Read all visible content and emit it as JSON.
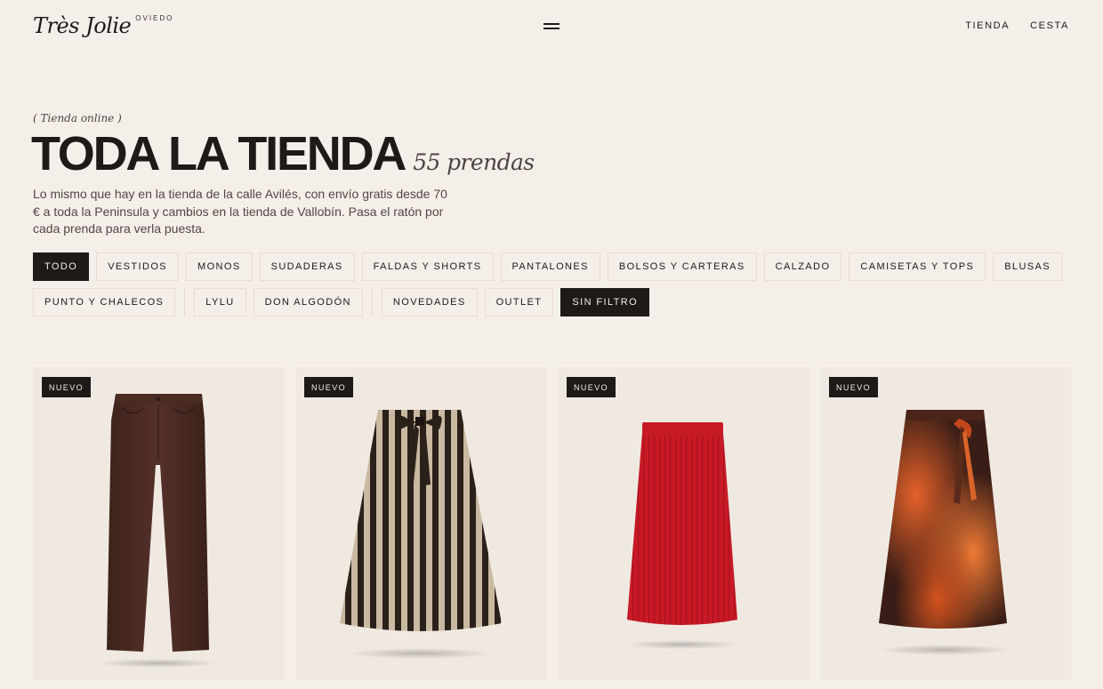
{
  "header": {
    "logo": "Très Jolie",
    "city": "OVIEDO",
    "nav": [
      "TIENDA",
      "CESTA"
    ]
  },
  "intro": {
    "kicker": "( Tienda online )",
    "title": "TODA LA TIENDA",
    "count": "55 prendas",
    "description": "Lo mismo que hay en la tienda de la calle Avilés, con envío gratis desde 70 € a toda la Peninsula y cambios en la tienda de Vallobín. Pasa el ratón por cada prenda para verla puesta."
  },
  "filters": {
    "categories": [
      "TODO",
      "VESTIDOS",
      "MONOS",
      "SUDADERAS",
      "FALDAS Y SHORTS",
      "PANTALONES",
      "BOLSOS Y CARTERAS",
      "CALZADO",
      "CAMISETAS Y TOPS",
      "BLUSAS",
      "PUNTO Y CHALECOS"
    ],
    "brands": [
      "LYLU",
      "DON ALGODÓN"
    ],
    "tags": [
      "NOVEDADES",
      "OUTLET",
      "SIN FILTRO"
    ],
    "active_category": "TODO",
    "active_tag": "SIN FILTRO"
  },
  "products": [
    {
      "badge": "NUEVO",
      "icon": "brown-trousers-image",
      "color": "#4a2b22"
    },
    {
      "badge": "NUEVO",
      "icon": "striped-skirt-image",
      "color": "#2b211b"
    },
    {
      "badge": "NUEVO",
      "icon": "red-pleated-skirt-image",
      "color": "#c81a26"
    },
    {
      "badge": "NUEVO",
      "icon": "tie-dye-skirt-image",
      "color": "#8a3418"
    }
  ],
  "colors": {
    "background": "#f5efe9",
    "ink": "#1d1a18",
    "card": "#efe9e2"
  }
}
